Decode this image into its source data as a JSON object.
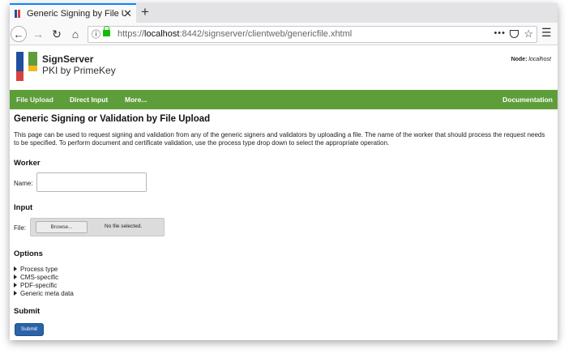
{
  "browser": {
    "tab_title": "Generic Signing by File Up",
    "tab_close": "✕",
    "new_tab": "+",
    "url_prefix": "https://",
    "url_host": "localhost",
    "url_rest": ":8442/signserver/clientweb/genericfile.xhtml",
    "url_more": "•••",
    "icons": [
      "back-icon",
      "forward-icon",
      "reload-icon",
      "home-icon",
      "info-icon",
      "lock-icon",
      "page-actions-icon",
      "pocket-icon",
      "bookmark-star-icon",
      "hamburger-menu-icon"
    ]
  },
  "header": {
    "logo_title": "SignServer",
    "logo_subtitle": "PKI by PrimeKey",
    "node_label": "Node:",
    "node_value": "localhost",
    "logo_colors": [
      "#1f4f9e",
      "#d9413a",
      "#5e9e3a",
      "#f3b71b"
    ]
  },
  "menu": {
    "items": [
      "File Upload",
      "Direct Input",
      "More..."
    ],
    "documentation": "Documentation",
    "color": "#5e9e3a"
  },
  "main": {
    "title": "Generic Signing or Validation by File Upload",
    "description": "This page can be used to request signing and validation from any of the generic signers and validators by uploading a file. The name of the worker that should process the request needs to be specified. To perform document and certificate validation, use the process type drop down to select the appropriate operation.",
    "worker_heading": "Worker",
    "name_label": "Name:",
    "name_value": "",
    "input_heading": "Input",
    "file_label": "File:",
    "browse_label": "Browse...",
    "file_status": "No file selected.",
    "options_heading": "Options",
    "options": [
      "Process type",
      "CMS-specific",
      "PDF-specific",
      "Generic meta data"
    ],
    "submit_heading": "Submit",
    "submit_label": "Submit",
    "submit_color": "#2a63a8"
  }
}
